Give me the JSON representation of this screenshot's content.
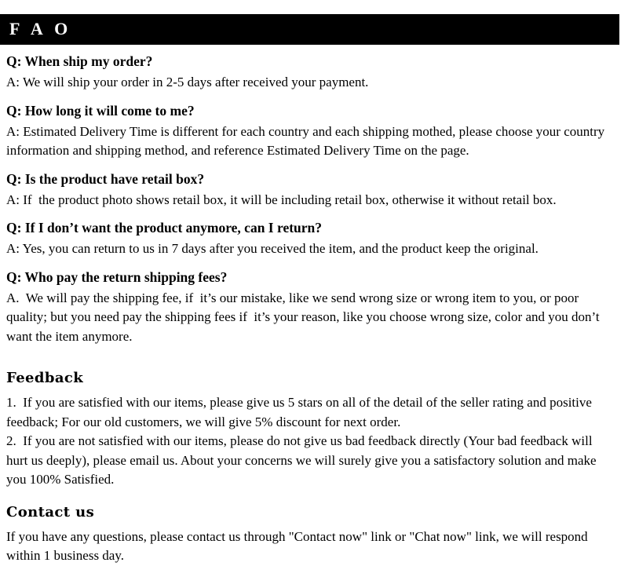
{
  "header": {
    "title": "F A O",
    "bar_color": "#000000",
    "text_color": "#ffffff"
  },
  "faq": {
    "items": [
      {
        "question": "Q: When ship my order?",
        "answer": "A: We will ship your order in 2-5 days after received your payment."
      },
      {
        "question": "Q: How long it will come to me?",
        "answer": "A: Estimated Delivery Time is different for each country and each shipping mothed, please choose your country information and shipping method, and reference Estimated Delivery Time on the page."
      },
      {
        "question": "Q: Is the product have retail box?",
        "answer": "A: If  the product photo shows retail box, it will be including retail box, otherwise it without retail box."
      },
      {
        "question": "Q: If I don’t want the product anymore, can I return?",
        "answer": "A: Yes, you can return to us in 7 days after you received the item, and the product keep the original."
      },
      {
        "question": "Q: Who pay the return shipping fees?",
        "answer": "A.  We will pay the shipping fee, if  it’s our mistake, like we send wrong size or wrong item to you, or poor quality; but you need pay the shipping fees if  it’s your reason, like you choose wrong size, color and you don’t want the item anymore."
      }
    ]
  },
  "feedback": {
    "heading": "Feedback",
    "body": "1.  If you are satisfied with our items, please give us 5 stars on all of the detail of the seller rating and positive feedback; For our old customers, we will give 5% discount for next order.\n2.  If you are not satisfied with our items, please do not give us bad feedback directly (Your bad feedback will hurt us deeply), please email us. About your concerns we will surely give you a satisfactory solution and make you 100% Satisfied."
  },
  "contact": {
    "heading": "Contact us",
    "body": "If you have any questions, please contact us through \"Contact now\" link or \"Chat now\" link, we will respond within 1 business day."
  }
}
